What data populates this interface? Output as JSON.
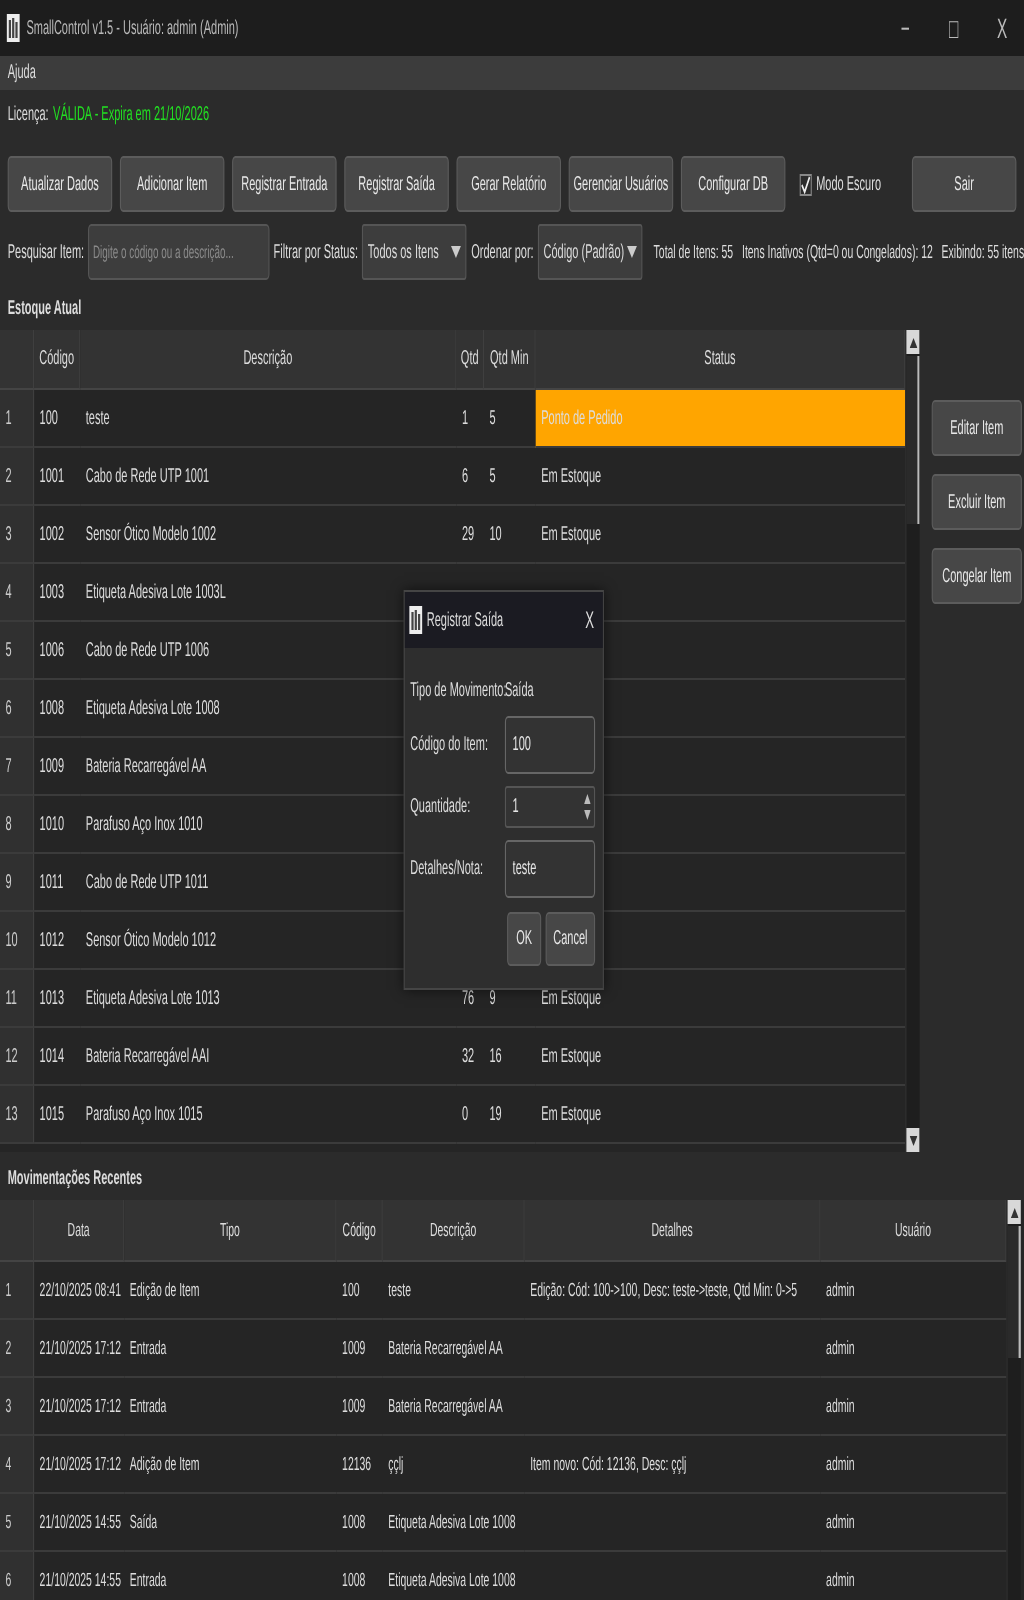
{
  "window": {
    "title": "SmallControl v1.5 - Usuário: admin (Admin)",
    "controls": [
      "−",
      "□",
      "X"
    ]
  },
  "menu": [
    {
      "label": "Ajuda"
    }
  ],
  "license": {
    "label": "Licença:",
    "status": "VÁLIDA - Expira em 21/10/2026"
  },
  "toolbar": {
    "buttons": [
      "Atualizar Dados",
      "Adicionar Item",
      "Registrar Entrada",
      "Registrar Saída",
      "Gerar Relatório",
      "Gerenciar Usuários",
      "Configurar DB"
    ],
    "dark_mode": {
      "label": "Modo Escuro",
      "checked": true
    },
    "exit": "Sair"
  },
  "filters": {
    "search_label": "Pesquisar Item:",
    "search": {
      "placeholder": "Digite o código ou a descrição..."
    },
    "status_label": "Filtrar por Status:",
    "status_value": "Todos os Itens",
    "sort_label": "Ordenar por:",
    "sort_value": "Código (Padrão)",
    "stats": [
      "Total de Itens: 55",
      "Itens Inativos (Qtd=0 ou Congelados): 12",
      "Exibindo: 55 itens"
    ]
  },
  "stock": {
    "title": "Estoque Atual",
    "columns": [
      "Código",
      "Descrição",
      "Qtd",
      "Qtd Min",
      "Status"
    ],
    "rows": [
      {
        "number": "1",
        "cells": [
          "100",
          "teste",
          "1",
          "5",
          "Ponto de Pedido"
        ],
        "color": "#ffa500"
      },
      {
        "number": "2",
        "cells": [
          "1001",
          "Cabo de Rede UTP 1001",
          "6",
          "5",
          "Em Estoque"
        ]
      },
      {
        "number": "3",
        "cells": [
          "1002",
          "Sensor Ótico Modelo 1002",
          "29",
          "10",
          "Em Estoque"
        ]
      },
      {
        "number": "4",
        "cells": [
          "1003",
          "Etiqueta Adesiva Lote 1003L"
        ]
      },
      {
        "number": "5",
        "cells": [
          "1006",
          "Cabo de Rede UTP 1006"
        ]
      },
      {
        "number": "6",
        "cells": [
          "1008",
          "Etiqueta Adesiva Lote 1008"
        ]
      },
      {
        "number": "7",
        "cells": [
          "1009",
          "Bateria Recarregável AA"
        ]
      },
      {
        "number": "8",
        "cells": [
          "1010",
          "Parafuso Aço Inox 1010"
        ]
      },
      {
        "number": "9",
        "cells": [
          "1011",
          "Cabo de Rede UTP 1011"
        ]
      },
      {
        "number": "10",
        "cells": [
          "1012",
          "Sensor Ótico Modelo 1012"
        ]
      },
      {
        "number": "11",
        "cells": [
          "1013",
          "Etiqueta Adesiva Lote 1013",
          "76",
          "9",
          "Em Estoque"
        ]
      },
      {
        "number": "12",
        "cells": [
          "1014",
          "Bateria Recarregável AAI",
          "32",
          "16",
          "Em Estoque"
        ]
      },
      {
        "number": "13",
        "cells": [
          "1015",
          "Parafuso Aço Inox 1015",
          "0",
          "19",
          "Em Estoque"
        ]
      }
    ]
  },
  "item_actions": [
    "Editar Item",
    "Excluir Item",
    "Congelar Item"
  ],
  "movements": {
    "title": "Movimentações Recentes",
    "columns": [
      "Data",
      "Tipo",
      "Código",
      "Descrição",
      "Detalhes",
      "Usuário"
    ],
    "rows": [
      {
        "number": "1",
        "cells": [
          "22/10/2025 08:41",
          "Edição de Item",
          "100",
          "teste",
          "Edição: Cód: 100->100, Desc: teste->teste, Qtd Min: 0->5",
          "admin"
        ]
      },
      {
        "number": "2",
        "cells": [
          "21/10/2025 17:12",
          "Entrada",
          "1009",
          "Bateria Recarregável AA",
          null,
          "admin"
        ]
      },
      {
        "number": "3",
        "cells": [
          "21/10/2025 17:12",
          "Entrada",
          "1009",
          "Bateria Recarregável AA",
          null,
          "admin"
        ]
      },
      {
        "number": "4",
        "cells": [
          "21/10/2025 17:12",
          "Adição de Item",
          "12136",
          "ççlj",
          "Item novo: Cód: 12136, Desc: ççlj",
          "admin"
        ]
      },
      {
        "number": "5",
        "cells": [
          "21/10/2025 14:55",
          "Saída",
          "1008",
          "Etiqueta Adesiva Lote 1008",
          null,
          "admin"
        ]
      },
      {
        "number": "6",
        "cells": [
          "21/10/2025 14:55",
          "Entrada",
          "1008",
          "Etiqueta Adesiva Lote 1008",
          null,
          "admin"
        ]
      }
    ]
  },
  "dialog": {
    "title": "Registrar Saída",
    "close": "X",
    "fields": [
      {
        "label": "Tipo de Movimento:",
        "kind": "static",
        "value": "Saída"
      },
      {
        "label": "Código do Item:",
        "kind": "input",
        "value": "100"
      },
      {
        "label": "Quantidade:",
        "kind": "spinner",
        "value": "1"
      },
      {
        "label": "Detalhes/Nota:",
        "kind": "input",
        "value": "teste"
      }
    ],
    "buttons": [
      "OK",
      "Cancel"
    ]
  }
}
